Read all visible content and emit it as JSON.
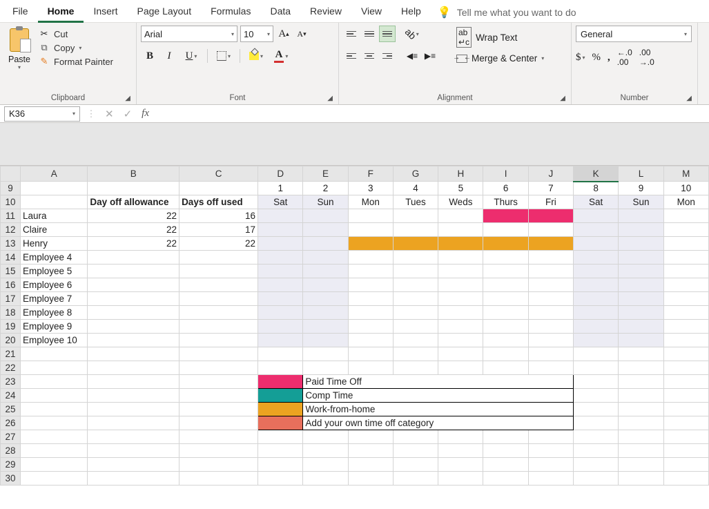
{
  "menu": {
    "items": [
      "File",
      "Home",
      "Insert",
      "Page Layout",
      "Formulas",
      "Data",
      "Review",
      "View",
      "Help"
    ],
    "active": "Home",
    "tell_me": "Tell me what you want to do"
  },
  "ribbon": {
    "clipboard": {
      "paste": "Paste",
      "cut": "Cut",
      "copy": "Copy",
      "format_painter": "Format Painter",
      "group_label": "Clipboard"
    },
    "font": {
      "name": "Arial",
      "size": "10",
      "group_label": "Font"
    },
    "alignment": {
      "group_label": "Alignment"
    },
    "wrap": {
      "wrap_text": "Wrap Text",
      "merge_center": "Merge & Center"
    },
    "number": {
      "format": "General",
      "group_label": "Number"
    }
  },
  "formula_bar": {
    "name_box": "K36",
    "fx": "fx",
    "value": ""
  },
  "columns": [
    "A",
    "B",
    "C",
    "D",
    "E",
    "F",
    "G",
    "H",
    "I",
    "J",
    "K",
    "L",
    "M"
  ],
  "selected_column": "K",
  "row_numbers": [
    9,
    10,
    11,
    12,
    13,
    14,
    15,
    16,
    17,
    18,
    19,
    20,
    21,
    22,
    23,
    24,
    25,
    26,
    27,
    28,
    29,
    30
  ],
  "header_row9": {
    "nums": [
      "1",
      "2",
      "3",
      "4",
      "5",
      "6",
      "7",
      "8",
      "9",
      "10"
    ]
  },
  "header_row10": {
    "allowance": "Day off allowance",
    "used": "Days off used",
    "days": [
      "Sat",
      "Sun",
      "Mon",
      "Tues",
      "Weds",
      "Thurs",
      "Fri",
      "Sat",
      "Sun",
      "Mon"
    ]
  },
  "employees": [
    {
      "name": "Laura",
      "allowance": "22",
      "used": "16",
      "pto": [
        6,
        7
      ],
      "wfh": []
    },
    {
      "name": "Claire",
      "allowance": "22",
      "used": "17",
      "pto": [],
      "wfh": []
    },
    {
      "name": "Henry",
      "allowance": "22",
      "used": "22",
      "pto": [],
      "wfh": [
        3,
        4,
        5,
        6,
        7
      ]
    },
    {
      "name": "Employee 4",
      "allowance": "",
      "used": "",
      "pto": [],
      "wfh": []
    },
    {
      "name": "Employee 5",
      "allowance": "",
      "used": "",
      "pto": [],
      "wfh": []
    },
    {
      "name": "Employee 6",
      "allowance": "",
      "used": "",
      "pto": [],
      "wfh": []
    },
    {
      "name": "Employee 7",
      "allowance": "",
      "used": "",
      "pto": [],
      "wfh": []
    },
    {
      "name": "Employee 8",
      "allowance": "",
      "used": "",
      "pto": [],
      "wfh": []
    },
    {
      "name": "Employee 9",
      "allowance": "",
      "used": "",
      "pto": [],
      "wfh": []
    },
    {
      "name": "Employee 10",
      "allowance": "",
      "used": "",
      "pto": [],
      "wfh": []
    }
  ],
  "weekend_cols": [
    1,
    2,
    8,
    9
  ],
  "legend": [
    {
      "cls": "leg-pto",
      "label": "Paid Time Off"
    },
    {
      "cls": "leg-comp",
      "label": "Comp Time"
    },
    {
      "cls": "leg-wfh",
      "label": "Work-from-home"
    },
    {
      "cls": "leg-own",
      "label": "Add your own time off category"
    }
  ]
}
